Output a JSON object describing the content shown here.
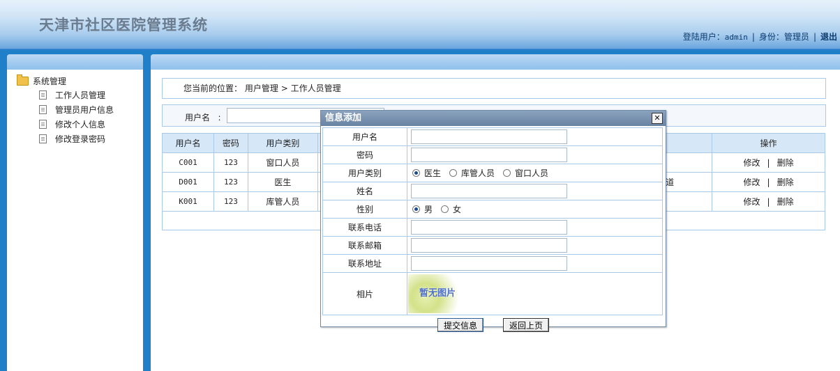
{
  "app": {
    "title": "天津市社区医院管理系统"
  },
  "userbar": {
    "login_label": "登陆用户：",
    "login_user": "admin",
    "role_label": "身份：",
    "role_value": "管理员",
    "logout": "退出"
  },
  "sidebar": {
    "root": "系统管理",
    "items": [
      {
        "label": "工作人员管理"
      },
      {
        "label": "管理员用户信息"
      },
      {
        "label": "修改个人信息"
      },
      {
        "label": "修改登录密码"
      }
    ]
  },
  "breadcrumb": {
    "prefix": "您当前的位置：",
    "path1": "用户管理",
    "arrow": ">",
    "path2": "工作人员管理"
  },
  "search": {
    "label": "用户名",
    "colon": ":",
    "value": ""
  },
  "table": {
    "headers": [
      "用户名",
      "密码",
      "用户类别",
      "操作"
    ],
    "rows": [
      {
        "username": "C001",
        "password": "123",
        "type": "窗口人员",
        "extra": "",
        "edit": "修改",
        "delete": "删除"
      },
      {
        "username": "D001",
        "password": "123",
        "type": "医生",
        "extra": "道",
        "edit": "修改",
        "delete": "删除"
      },
      {
        "username": "K001",
        "password": "123",
        "type": "库管人员",
        "extra": "",
        "edit": "修改",
        "delete": "删除"
      }
    ],
    "op_sep": "|"
  },
  "dialog": {
    "title": "信息添加",
    "close": "✕",
    "fields": {
      "username": "用户名",
      "password": "密码",
      "user_type": "用户类别",
      "name": "姓名",
      "gender": "性别",
      "phone": "联系电话",
      "email": "联系邮箱",
      "address": "联系地址",
      "photo": "相片"
    },
    "user_type_options": [
      "医生",
      "库管人员",
      "窗口人员"
    ],
    "user_type_selected": "医生",
    "gender_options": [
      "男",
      "女"
    ],
    "gender_selected": "男",
    "photo_placeholder": "暂无图片",
    "submit": "提交信息",
    "back": "返回上页"
  },
  "colors": {
    "header_bg": "#a9cdee",
    "accent_blue": "#1f7fc8",
    "table_header": "#d6e8f8",
    "border": "#a8c9e8",
    "dialog_title": "#6983a3"
  }
}
